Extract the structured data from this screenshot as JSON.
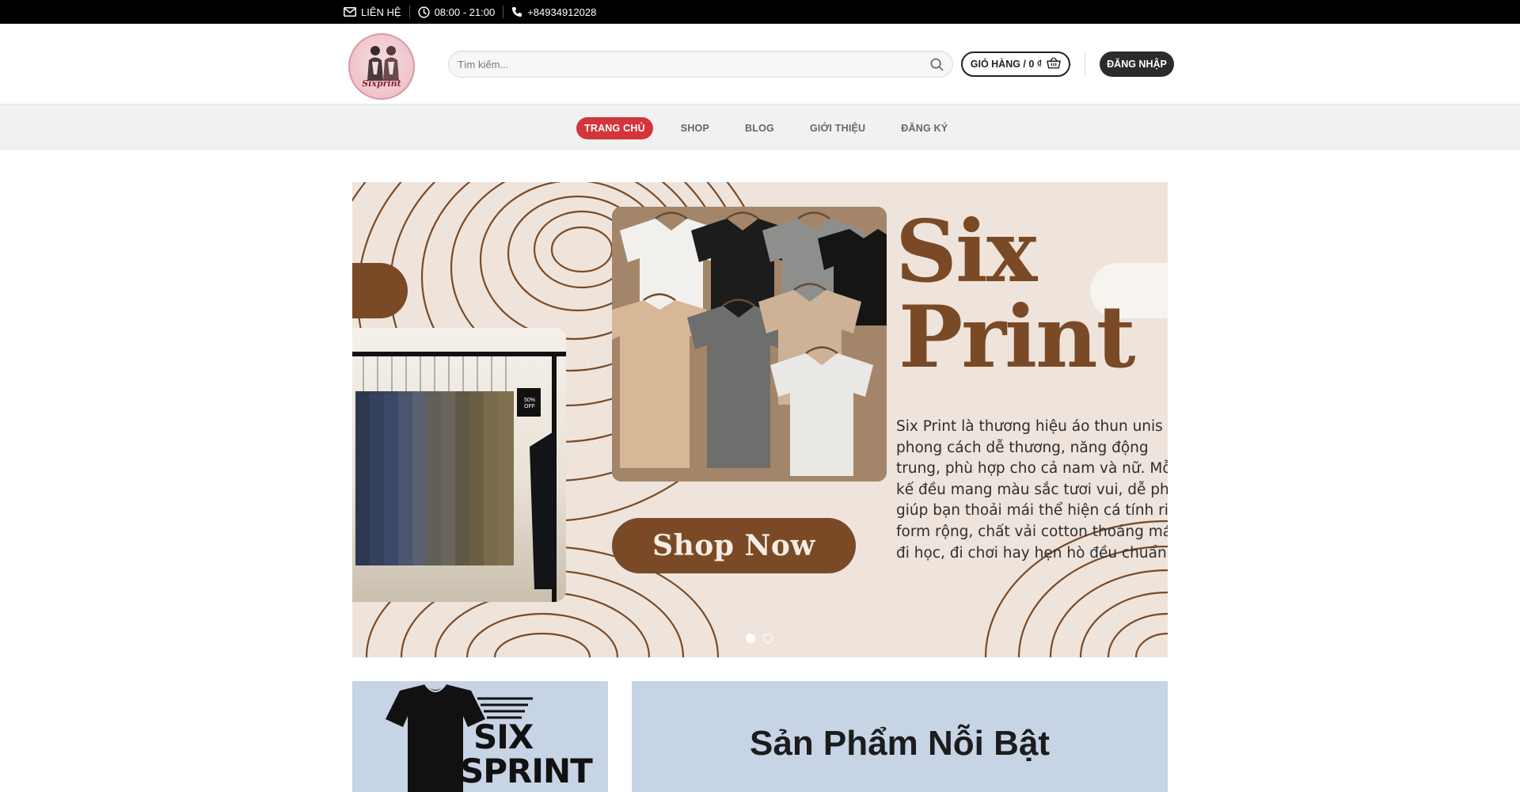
{
  "topbar": {
    "contact_label": "LIÊN HỆ",
    "hours": "08:00 - 21:00",
    "phone": "+84934912028"
  },
  "header": {
    "logo_text": "Sixprint",
    "search_placeholder": "Tìm kiếm...",
    "cart_label": "GIỎ HÀNG / 0 ₫",
    "login_label": "ĐĂNG NHẬP"
  },
  "nav": {
    "items": [
      {
        "label": "TRANG CHỦ",
        "active": true
      },
      {
        "label": "SHOP",
        "active": false
      },
      {
        "label": "BLOG",
        "active": false
      },
      {
        "label": "GIỚI THIỆU",
        "active": false
      },
      {
        "label": "ĐĂNG KÝ",
        "active": false
      }
    ]
  },
  "hero": {
    "brand_line1": "Six",
    "brand_line2": "Print",
    "description_lines": [
      "Six Print là thương hiệu áo thun unis",
      "phong cách dễ thương, năng động",
      "trung, phù hợp cho cả nam và nữ. Mỗ",
      "kế đều mang màu sắc tươi vui, dễ ph",
      "giúp bạn thoải mái thể hiện cá tính riê",
      "form rộng, chất vải cotton thoáng má",
      "đi học, đi chơi hay hẹn hò đều chuẩn xi"
    ],
    "cta": "Shop Now",
    "sale_tag": "50% OFF",
    "slide_count": 2,
    "active_slide": 1
  },
  "cards": {
    "left_word1": "SIX",
    "left_word2": "SPRINT",
    "featured_title": "Sản Phẩm Nỗi Bật"
  },
  "colors": {
    "topbar_bg": "#000000",
    "nav_active": "#d2353a",
    "brand_brown": "#7a4a26",
    "hero_bg": "#eee4dc",
    "card_bg": "#c7d4e6",
    "login_bg": "#2b2b2b"
  },
  "icons": {
    "contact": "envelope-icon",
    "hours": "clock-icon",
    "phone": "phone-icon",
    "search": "search-icon",
    "cart": "basket-icon"
  }
}
